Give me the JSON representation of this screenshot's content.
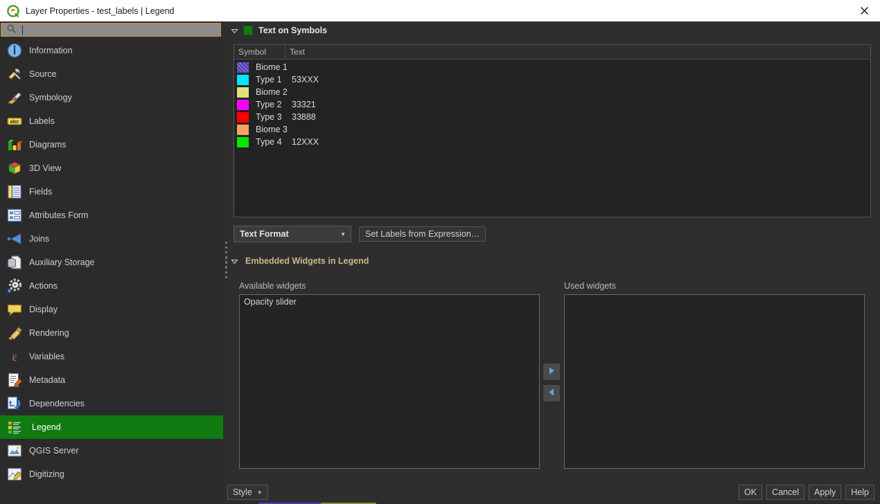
{
  "window": {
    "title": "Layer Properties - test_labels | Legend",
    "logo_icon": "qgis-logo-icon",
    "close_icon": "close-icon"
  },
  "search": {
    "placeholder": "",
    "value": "",
    "icon": "search-icon"
  },
  "sidebar": {
    "items": [
      {
        "label": "Information",
        "icon": "information-icon",
        "selected": false
      },
      {
        "label": "Source",
        "icon": "source-icon",
        "selected": false
      },
      {
        "label": "Symbology",
        "icon": "symbology-icon",
        "selected": false
      },
      {
        "label": "Labels",
        "icon": "labels-abc-icon",
        "selected": false
      },
      {
        "label": "Diagrams",
        "icon": "diagrams-icon",
        "selected": false
      },
      {
        "label": "3D View",
        "icon": "3d-view-cube-icon",
        "selected": false
      },
      {
        "label": "Fields",
        "icon": "fields-icon",
        "selected": false
      },
      {
        "label": "Attributes Form",
        "icon": "attributes-form-icon",
        "selected": false
      },
      {
        "label": "Joins",
        "icon": "joins-icon",
        "selected": false
      },
      {
        "label": "Auxiliary Storage",
        "icon": "auxiliary-storage-icon",
        "selected": false
      },
      {
        "label": "Actions",
        "icon": "actions-gear-icon",
        "selected": false
      },
      {
        "label": "Display",
        "icon": "display-balloon-icon",
        "selected": false
      },
      {
        "label": "Rendering",
        "icon": "rendering-brush-icon",
        "selected": false
      },
      {
        "label": "Variables",
        "icon": "variables-epsilon-icon",
        "selected": false
      },
      {
        "label": "Metadata",
        "icon": "metadata-pencil-icon",
        "selected": false
      },
      {
        "label": "Dependencies",
        "icon": "dependencies-icon",
        "selected": false
      },
      {
        "label": "Legend",
        "icon": "legend-icon",
        "selected": true
      },
      {
        "label": "QGIS Server",
        "icon": "qgis-server-icon",
        "selected": false
      },
      {
        "label": "Digitizing",
        "icon": "digitizing-icon",
        "selected": false
      }
    ],
    "selected_color": "#117a11"
  },
  "text_on_symbols": {
    "group_title": "Text on Symbols",
    "checked": true,
    "collapse_icon": "chevron-down-icon",
    "columns": [
      "Symbol",
      "Text"
    ],
    "rows": [
      {
        "name": "Biome 1",
        "text": "",
        "color": "#7b68d8",
        "hatched": true
      },
      {
        "name": "Type 1",
        "text": "53XXX",
        "color": "#00e5ff",
        "hatched": false
      },
      {
        "name": "Biome 2",
        "text": "",
        "color": "#dbe07a",
        "hatched": false
      },
      {
        "name": "Type 2",
        "text": "33321",
        "color": "#ff00ff",
        "hatched": false
      },
      {
        "name": "Type 3",
        "text": "33888",
        "color": "#ff0000",
        "hatched": false
      },
      {
        "name": "Biome 3",
        "text": "",
        "color": "#f4a460",
        "hatched": false
      },
      {
        "name": "Type 4",
        "text": "12XXX",
        "color": "#00e800",
        "hatched": false
      }
    ],
    "text_format_value": "Text Format",
    "set_labels_button": "Set Labels from Expression…"
  },
  "embedded_widgets": {
    "group_title": "Embedded Widgets in Legend",
    "collapse_icon": "chevron-down-icon",
    "available_label": "Available widgets",
    "used_label": "Used widgets",
    "available_items": [
      "Opacity slider"
    ],
    "used_items": [],
    "move_right_icon": "triangle-right-icon",
    "move_left_icon": "triangle-left-icon"
  },
  "footer": {
    "style_label": "Style",
    "style_arrow_icon": "chevron-down-icon",
    "buttons": [
      "OK",
      "Cancel",
      "Apply",
      "Help"
    ]
  }
}
